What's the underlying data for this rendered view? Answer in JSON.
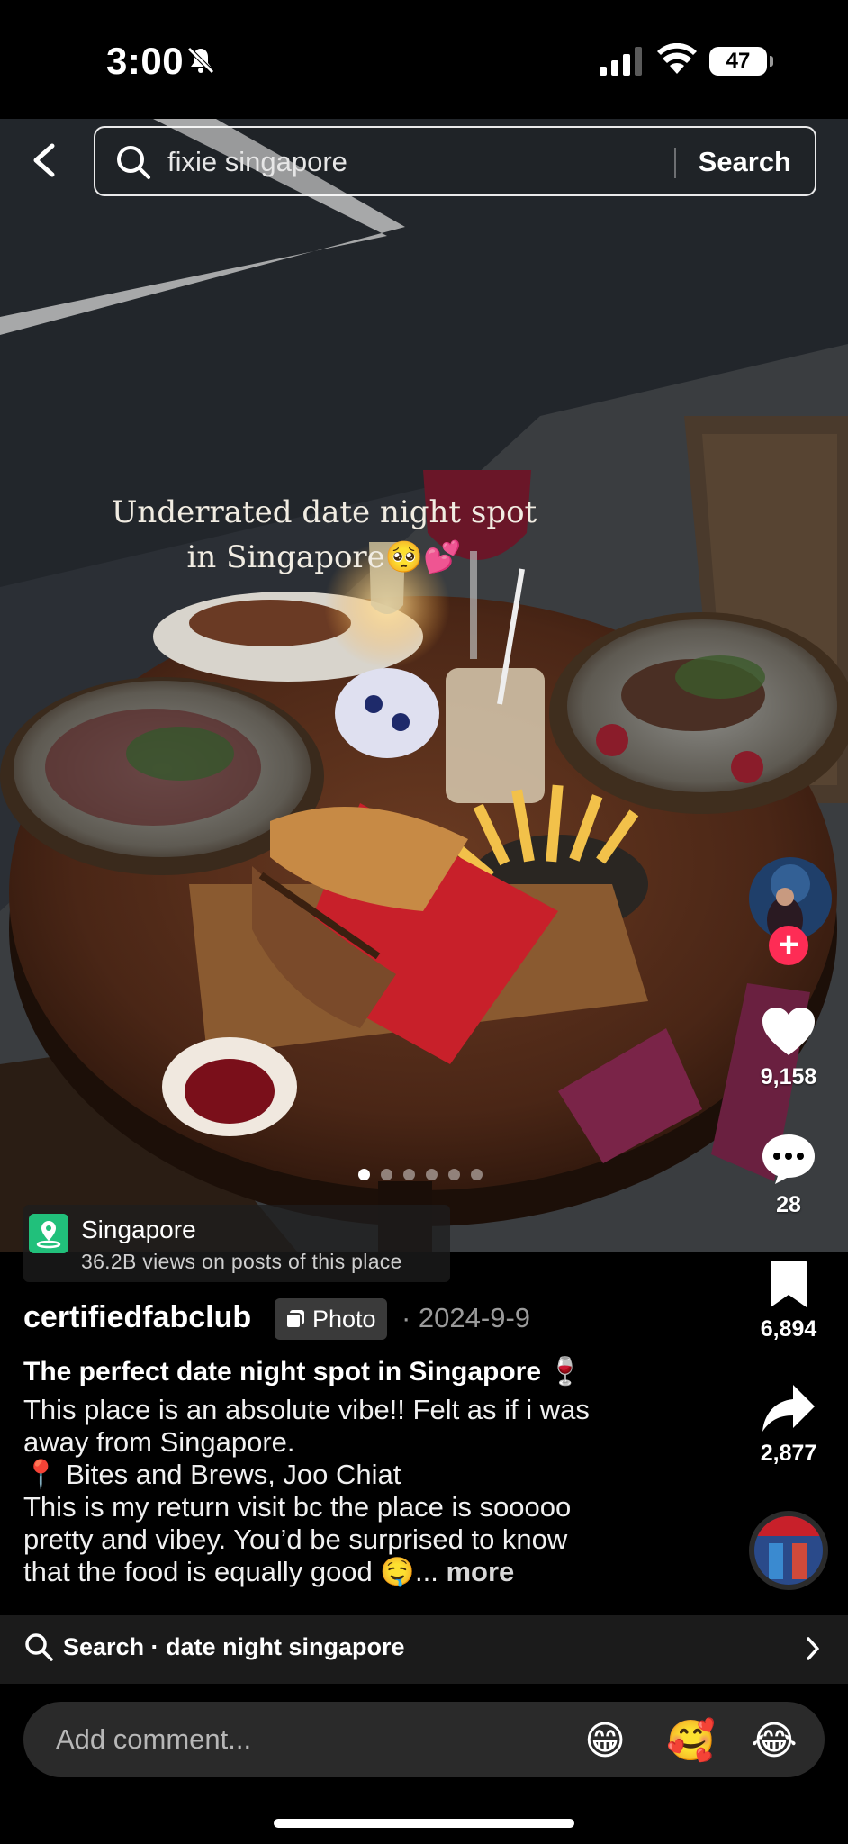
{
  "status_bar": {
    "time": "3:00",
    "battery": "47",
    "icons": [
      "bell-slash-icon",
      "cellular-signal-icon",
      "wifi-icon",
      "battery-icon"
    ]
  },
  "search": {
    "query": "fixie singapore",
    "submit_label": "Search",
    "icons": [
      "back-arrow-icon",
      "search-icon"
    ]
  },
  "photo": {
    "overlay_text_line1": "Underrated date night spot",
    "overlay_text_line2": "in Singapore🥺💕",
    "carousel_total": 6,
    "carousel_active": 1
  },
  "location": {
    "name": "Singapore",
    "views": "36.2B views on posts of this place",
    "color": "#21c07b"
  },
  "actions": {
    "likes": "9,158",
    "comments": "28",
    "saves": "6,894",
    "shares": "2,877",
    "follow_color": "#fe2c55"
  },
  "post": {
    "username": "certifiedfabclub",
    "type_badge": "Photo",
    "date": "· 2024-9-9",
    "title": "The perfect date night spot in Singapore 🍷",
    "body_lines": [
      "This place is an absolute vibe!! Felt as if i was",
      "away from Singapore.",
      "📍 Bites and Brews, Joo Chiat",
      "This is my return visit bc the place is sooooo",
      "pretty and vibey. You’d be surprised to know",
      "that the food is equally good 🤤..."
    ],
    "more_label": "more"
  },
  "related_search": {
    "label": "Search · date night singapore"
  },
  "comment": {
    "placeholder": "Add comment...",
    "emojis": [
      "😁",
      "🥰",
      "😂"
    ]
  }
}
